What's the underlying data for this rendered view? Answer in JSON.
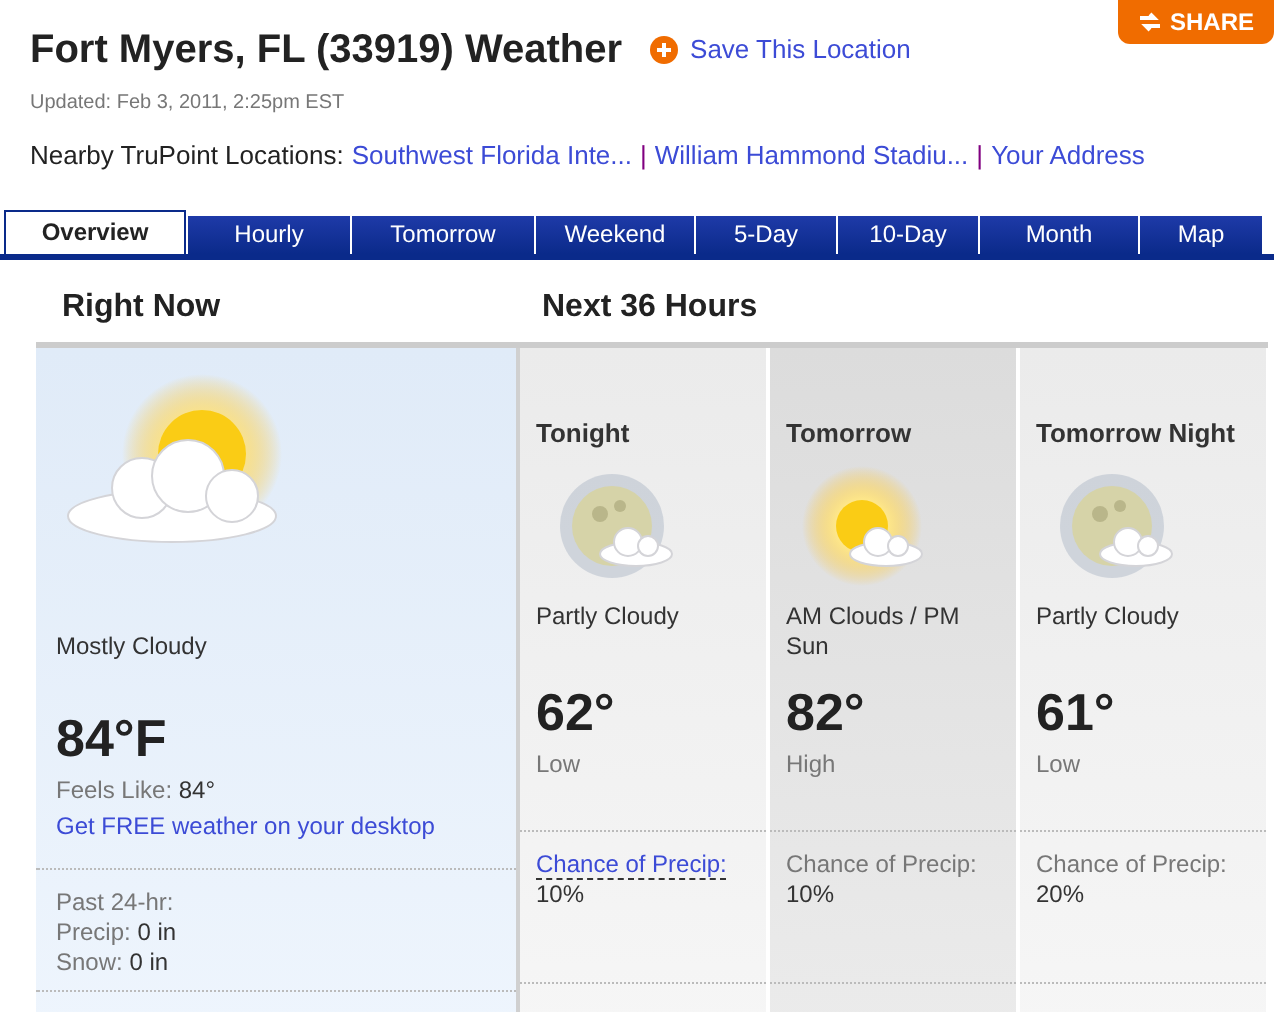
{
  "header": {
    "title": "Fort Myers, FL (33919) Weather",
    "save_label": "Save This Location",
    "share": "SHARE",
    "updated": "Updated: Feb 3, 2011, 2:25pm EST",
    "nearby_label": "Nearby TruPoint Locations:",
    "nearby_links": [
      "Southwest Florida Inte...",
      "William Hammond Stadiu...",
      "Your Address"
    ],
    "separator": "|"
  },
  "tabs": [
    {
      "label": "Overview",
      "selected": true
    },
    {
      "label": "Hourly",
      "selected": false
    },
    {
      "label": "Tomorrow",
      "selected": false
    },
    {
      "label": "Weekend",
      "selected": false
    },
    {
      "label": "5-Day",
      "selected": false
    },
    {
      "label": "10-Day",
      "selected": false
    },
    {
      "label": "Month",
      "selected": false
    },
    {
      "label": "Map",
      "selected": false
    }
  ],
  "right_now": {
    "heading": "Right Now",
    "kind": "sun-cloud",
    "condition": "Mostly Cloudy",
    "temp": "84°F",
    "feels_label": "Feels Like:",
    "feels_value": "84°",
    "desktop_link": "Get FREE weather on your desktop",
    "past_label": "Past 24-hr:",
    "precip_label": "Precip:",
    "precip_value": "0 in",
    "snow_label": "Snow:",
    "snow_value": "0 in"
  },
  "next_36": {
    "heading": "Next 36 Hours",
    "periods": [
      {
        "name": "Tonight",
        "kind": "moon-cloud",
        "condition": "Partly Cloudy",
        "temp": "62°",
        "temp_label": "Low",
        "precip_label": "Chance of Precip:",
        "precip_value": "10%",
        "precip_is_link": true,
        "shaded": false
      },
      {
        "name": "Tomorrow",
        "kind": "sun-cloud",
        "condition": "AM Clouds / PM Sun",
        "temp": "82°",
        "temp_label": "High",
        "precip_label": "Chance of Precip:",
        "precip_value": "10%",
        "precip_is_link": false,
        "shaded": true
      },
      {
        "name": "Tomorrow Night",
        "kind": "moon-cloud",
        "condition": "Partly Cloudy",
        "temp": "61°",
        "temp_label": "Low",
        "precip_label": "Chance of Precip:",
        "precip_value": "20%",
        "precip_is_link": false,
        "shaded": false
      }
    ]
  }
}
